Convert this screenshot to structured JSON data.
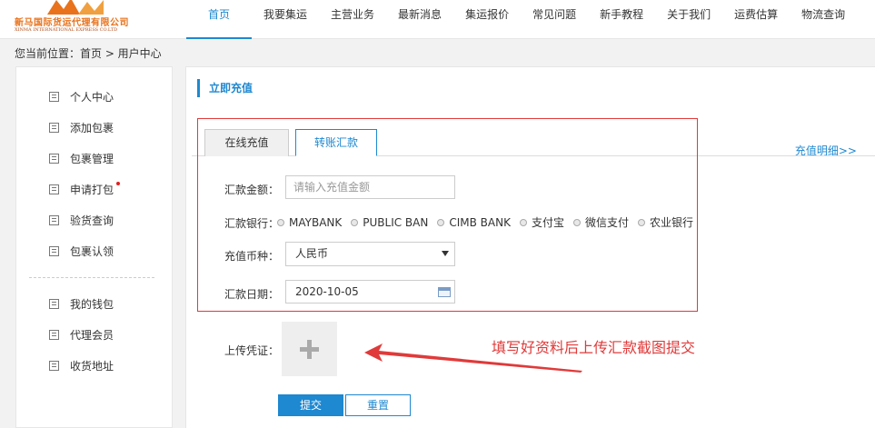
{
  "logo": {
    "cn": "新马国际货运代理有限公司",
    "en": "XINMA INTERNATIONAL EXPRESS CO.LTD"
  },
  "nav": [
    {
      "label": "首页"
    },
    {
      "label": "我要集运"
    },
    {
      "label": "主营业务"
    },
    {
      "label": "最新消息"
    },
    {
      "label": "集运报价"
    },
    {
      "label": "常见问题"
    },
    {
      "label": "新手教程"
    },
    {
      "label": "关于我们"
    },
    {
      "label": "运费估算"
    },
    {
      "label": "物流查询"
    }
  ],
  "breadcrumb": "您当前位置：首页 > 用户中心",
  "sidebar": {
    "items": [
      {
        "label": "个人中心"
      },
      {
        "label": "添加包裹"
      },
      {
        "label": "包裹管理"
      },
      {
        "label": "申请打包"
      },
      {
        "label": "验货查询"
      },
      {
        "label": "包裹认领"
      },
      {
        "label": "我的钱包"
      },
      {
        "label": "代理会员"
      },
      {
        "label": "收货地址"
      }
    ]
  },
  "main": {
    "section_title": "立即充值",
    "recharge_detail": "充值明细>>",
    "tabs": {
      "online": "在线充值",
      "transfer": "转账汇款"
    },
    "form": {
      "amount_label": "汇款金额：",
      "amount_placeholder": "请输入充值金额",
      "bank_label": "汇款银行：",
      "banks": [
        "MAYBANK",
        "PUBLIC BAN",
        "CIMB BANK",
        "支付宝",
        "微信支付",
        "农业银行"
      ],
      "currency_label": "充值币种：",
      "currency_value": "人民币",
      "date_label": "汇款日期：",
      "date_value": "2020-10-05",
      "upload_label": "上传凭证："
    },
    "annotation": "填写好资料后上传汇款截图提交",
    "buttons": {
      "submit": "提交",
      "reset": "重置"
    }
  },
  "colors": {
    "accent": "#1e88d0",
    "annotation": "#e03a3a",
    "logo": "#e8731c"
  }
}
